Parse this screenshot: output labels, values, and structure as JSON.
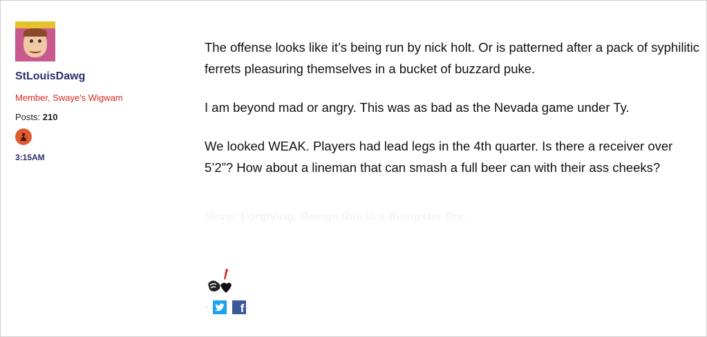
{
  "author": {
    "username": "StLouisDawg",
    "role": "Member, Swaye's Wigwam",
    "posts_label": "Posts:",
    "posts_count": "210",
    "time": "3:15AM",
    "avatar_icon": "mad-magazine-avatar",
    "badge_icon": "rank-badge-icon"
  },
  "post": {
    "paragraphs": [
      "The offense looks like it’s being run by nick holt. Or is patterned after a pack of syphilitic ferrets pleasuring themselves in a bucket of buzzard puke.",
      "I am beyond mad or angry. This was as bad as the Nevada game under Ty.",
      "We looked WEAK. Players had lead legs in the 4th quarter. Is there a receiver over 5’2”? How about a lineman that can smash a full beer can with their ass cheeks?"
    ],
    "signature_text": "Never Forgiving. Dawgs this is a dumpster fire."
  },
  "share": {
    "dot": "·",
    "twitter_icon": "twitter-icon",
    "facebook_icon": "facebook-icon",
    "facebook_glyph": "f"
  },
  "colors": {
    "username": "#2b2e6e",
    "role": "#d9261c",
    "badge": "#e05a2e",
    "twitter": "#1da1f2",
    "facebook": "#3b5998"
  }
}
